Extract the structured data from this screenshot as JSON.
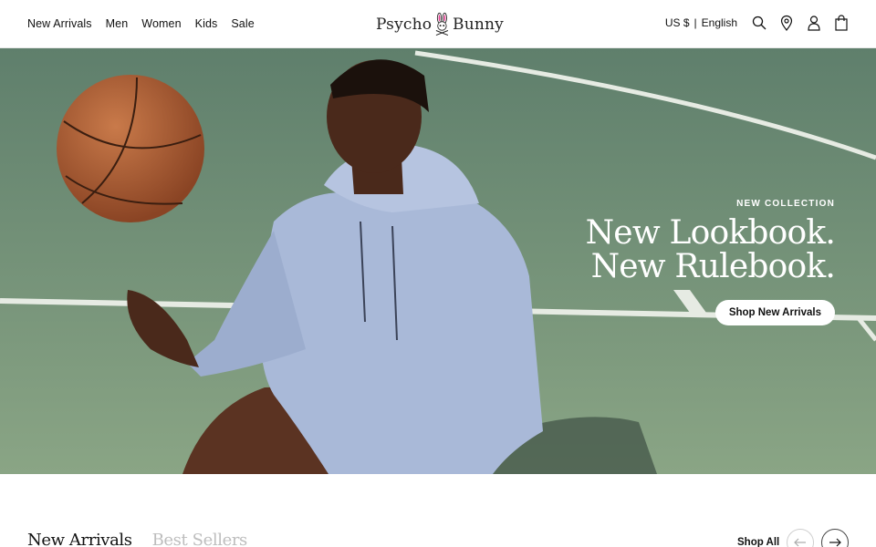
{
  "header": {
    "nav": [
      "New Arrivals",
      "Men",
      "Women",
      "Kids",
      "Sale"
    ],
    "logo_left": "Psycho",
    "logo_right": "Bunny",
    "currency": "US $",
    "separator": "|",
    "language": "English",
    "icons": [
      "search-icon",
      "location-pin-icon",
      "account-icon",
      "shopping-bag-icon"
    ]
  },
  "hero": {
    "eyebrow": "NEW COLLECTION",
    "headline_line1": "New Lookbook.",
    "headline_line2": "New Rulebook.",
    "cta": "Shop New Arrivals"
  },
  "section": {
    "tabs": [
      "New Arrivals",
      "Best Sellers"
    ],
    "shop_all": "Shop All",
    "prev_icon": "arrow-left-icon",
    "next_icon": "arrow-right-icon"
  },
  "colors": {
    "court_green": "#6f8d76",
    "hoodie_blue": "#a9b9d8",
    "basketball": "#b5663a"
  }
}
